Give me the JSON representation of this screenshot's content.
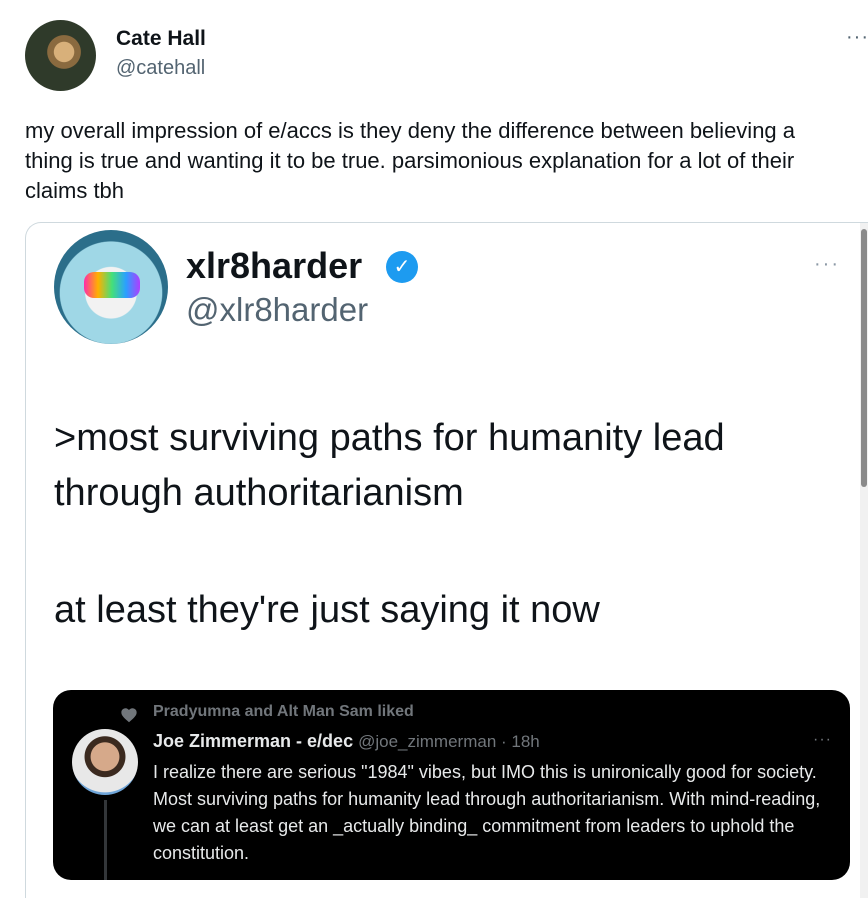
{
  "author": {
    "name": "Cate Hall",
    "handle": "@catehall"
  },
  "more_label": "···",
  "tweet_text": "my overall impression of e/accs is they deny the difference between believing a thing is true and wanting it to be true. parsimonious explanation for a lot of their claims tbh",
  "quoted": {
    "name": "xlr8harder",
    "handle": "@xlr8harder",
    "verified_mark": "✓",
    "paragraphs": [
      ">most surviving paths for humanity lead through authoritarianism",
      "at least they're just saying it now"
    ],
    "embed": {
      "liked_text": "Pradyumna and Alt Man Sam liked",
      "name": "Joe Zimmerman - e/dec",
      "handle_time": "@joe_zimmerman · 18h",
      "text": "I realize there are serious \"1984\" vibes, but IMO this is unironically good for society. Most surviving paths for humanity lead through authoritarianism. With mind-reading, we can at least get an _actually binding_ commitment from leaders to uphold the constitution."
    }
  },
  "colors": {
    "text_primary": "#0f1419",
    "text_secondary": "#536471",
    "verified_blue": "#1d9bf0",
    "embed_bg": "#000000"
  },
  "icons": [
    "more-icon",
    "verified-badge-icon",
    "heart-icon"
  ]
}
